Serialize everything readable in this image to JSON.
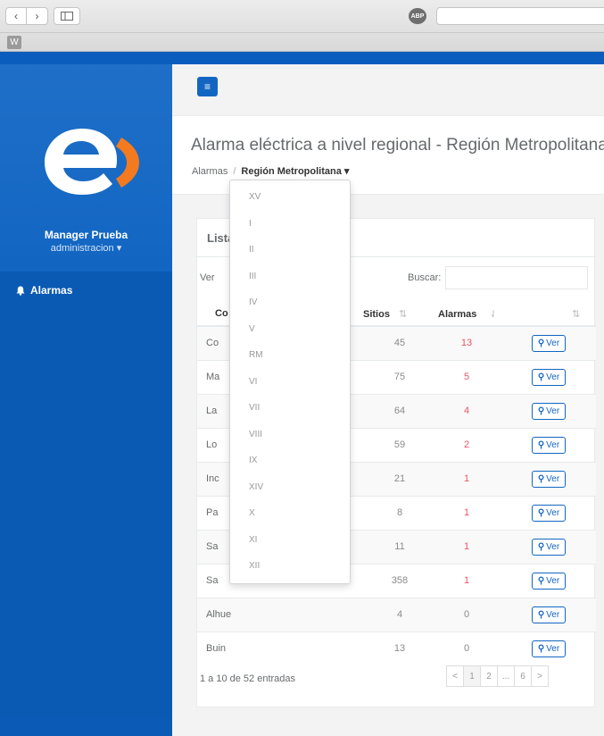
{
  "browser": {
    "abp_label": "ABP",
    "favicon_label": "W"
  },
  "sidebar": {
    "user_name": "Manager Prueba",
    "user_role": "administracion",
    "menu": [
      {
        "label": "Alarmas",
        "icon": "bell-icon"
      }
    ],
    "logo_colors": {
      "letter": "#ffffff",
      "arc": "#f47a20"
    }
  },
  "header": {
    "title": "Alarma eléctrica a nivel regional - Región Metropolitana",
    "breadcrumb": {
      "root": "Alarmas",
      "separator": "/",
      "current": "Región Metropolitana"
    }
  },
  "panel": {
    "title": "Lista",
    "show_label": "Ver",
    "search_label": "Buscar:",
    "search_value": "",
    "columns": [
      "Co",
      "Sitios",
      "Alarmas",
      ""
    ],
    "rows": [
      {
        "name": "Co",
        "sitios": "45",
        "alarmas": "13",
        "action": "Ver"
      },
      {
        "name": "Ma",
        "sitios": "75",
        "alarmas": "5",
        "action": "Ver"
      },
      {
        "name": "La",
        "sitios": "64",
        "alarmas": "4",
        "action": "Ver"
      },
      {
        "name": "Lo",
        "sitios": "59",
        "alarmas": "2",
        "action": "Ver"
      },
      {
        "name": "Inc",
        "sitios": "21",
        "alarmas": "1",
        "action": "Ver"
      },
      {
        "name": "Pa",
        "sitios": "8",
        "alarmas": "1",
        "action": "Ver"
      },
      {
        "name": "Sa",
        "sitios": "11",
        "alarmas": "1",
        "action": "Ver"
      },
      {
        "name": "Sa",
        "sitios": "358",
        "alarmas": "1",
        "action": "Ver"
      },
      {
        "name": "Alhue",
        "sitios": "4",
        "alarmas": "0",
        "action": "Ver"
      },
      {
        "name": "Buin",
        "sitios": "13",
        "alarmas": "0",
        "action": "Ver"
      }
    ],
    "info": "1 a 10 de 52 entradas",
    "pagination": [
      "<",
      "1",
      "2",
      "...",
      "6",
      ">"
    ],
    "active_page": "1"
  },
  "region_dropdown": {
    "items": [
      "XV",
      "I",
      "II",
      "III",
      "IV",
      "V",
      "RM",
      "VI",
      "VII",
      "VIII",
      "IX",
      "XIV",
      "X",
      "XI",
      "XII"
    ]
  },
  "colors": {
    "brand_blue": "#1266c2",
    "alarm_red": "#ed5565"
  }
}
